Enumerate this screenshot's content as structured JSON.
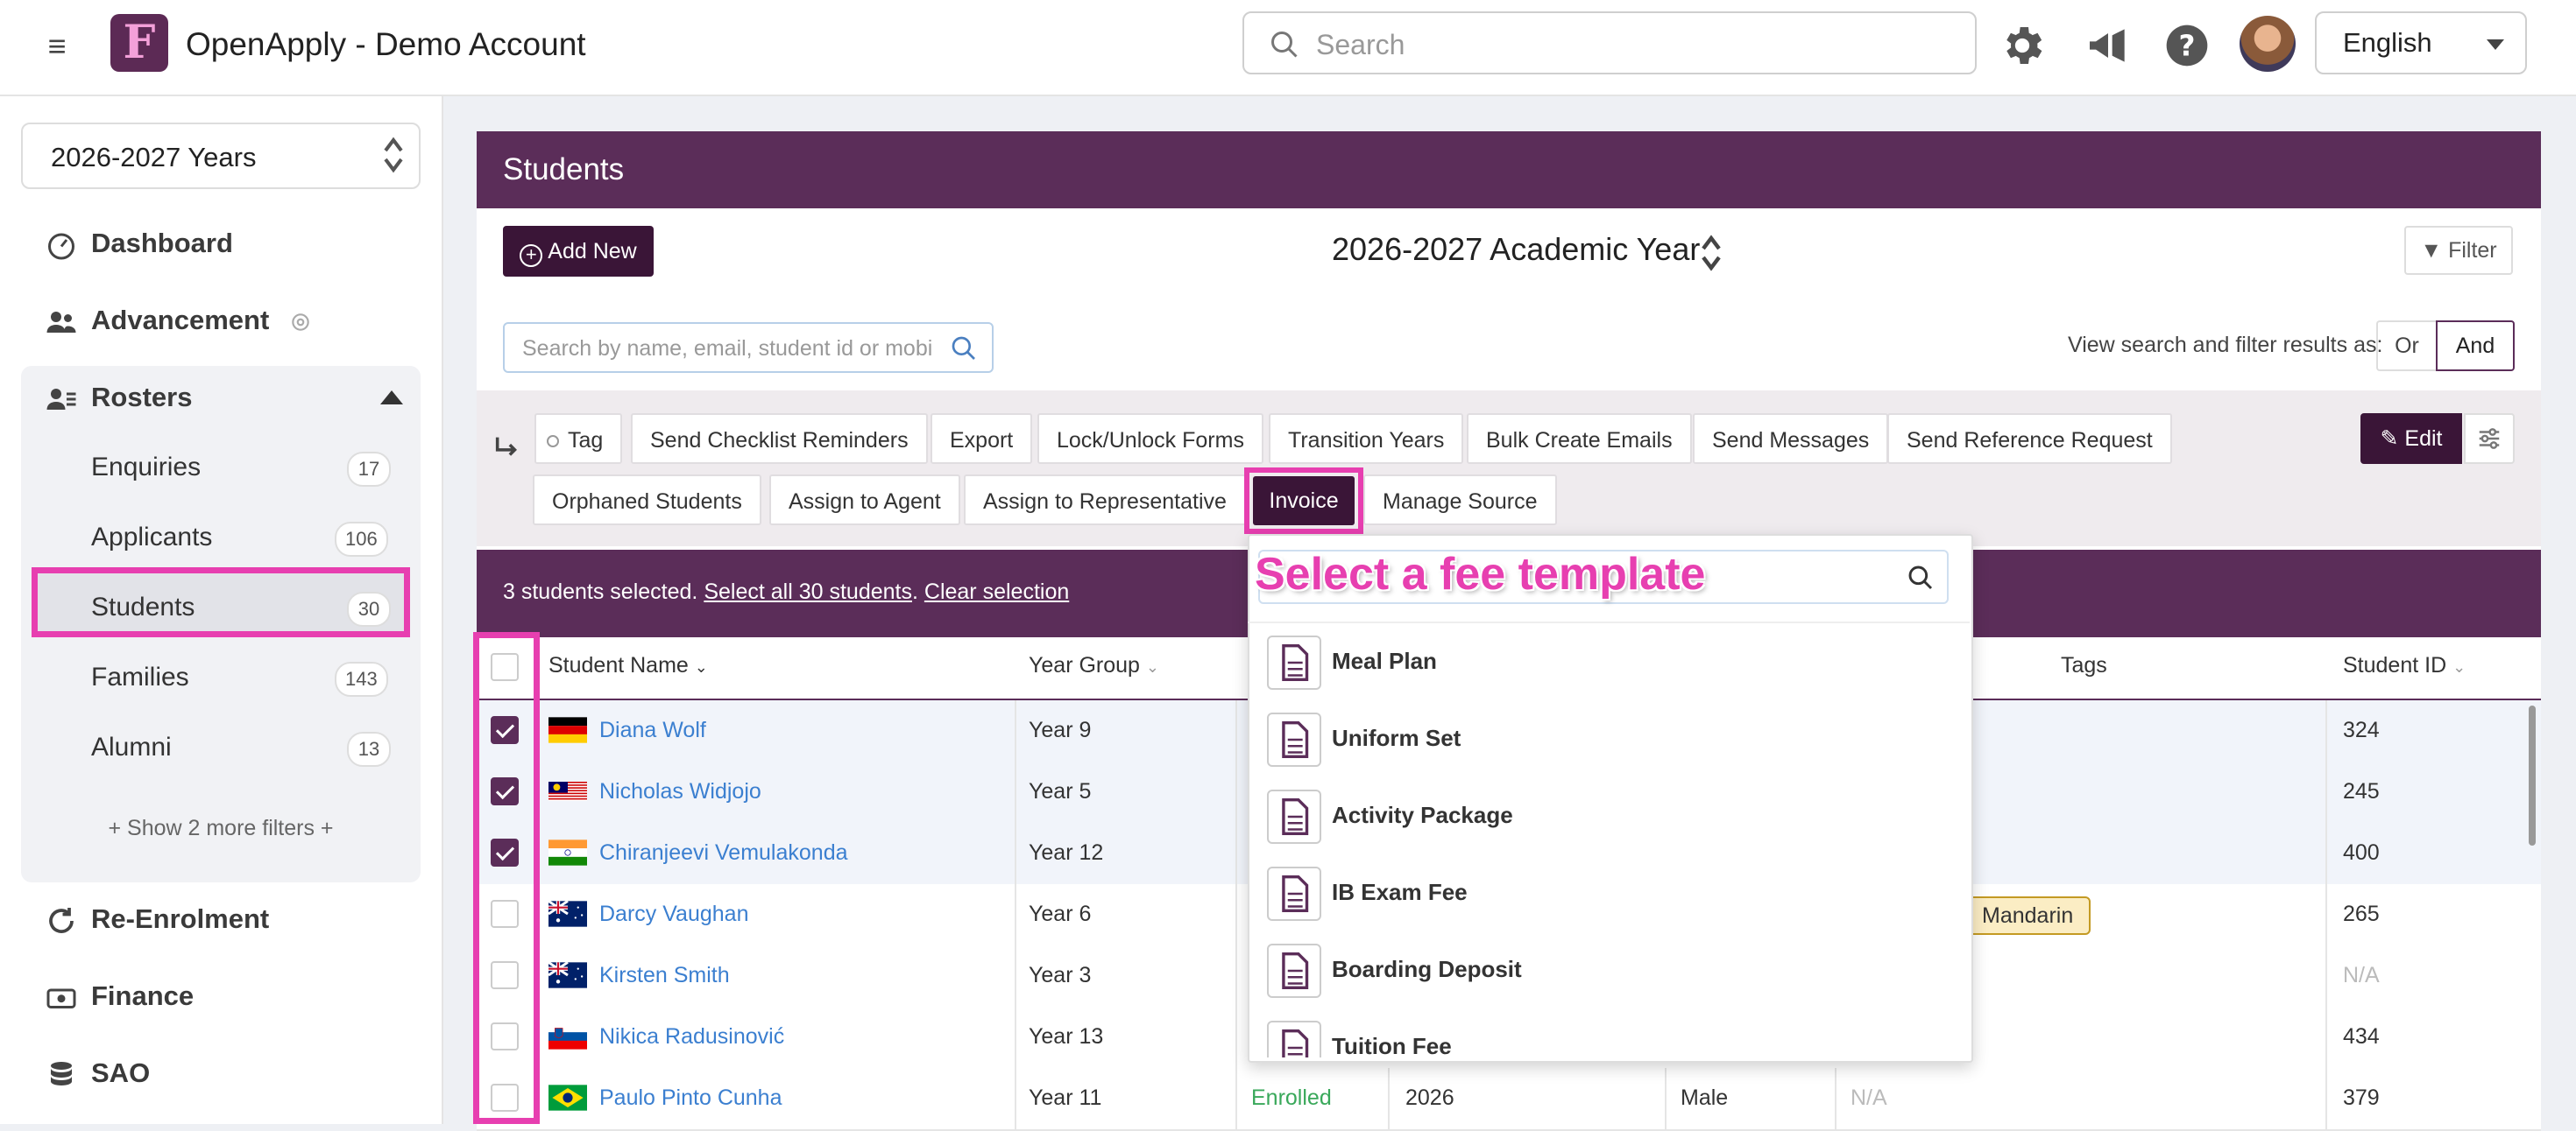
{
  "app": {
    "title": "OpenApply - Demo Account"
  },
  "topbar": {
    "search_placeholder": "Search",
    "language": "English"
  },
  "sidebar": {
    "year_select": "2026-2027 Years",
    "nav": [
      {
        "label": "Dashboard",
        "icon": "dashboard-icon"
      },
      {
        "label": "Advancement",
        "icon": "people-icon"
      },
      {
        "label": "Rosters",
        "icon": "roster-icon"
      }
    ],
    "rosters": [
      {
        "label": "Enquiries",
        "count": "17"
      },
      {
        "label": "Applicants",
        "count": "106"
      },
      {
        "label": "Students",
        "count": "30"
      },
      {
        "label": "Families",
        "count": "143"
      },
      {
        "label": "Alumni",
        "count": "13"
      }
    ],
    "show_more": "+ Show 2 more filters +",
    "nav_bottom": [
      {
        "label": "Re-Enrolment",
        "icon": "refresh-icon"
      },
      {
        "label": "Finance",
        "icon": "money-icon"
      },
      {
        "label": "SAO",
        "icon": "database-icon"
      }
    ]
  },
  "main": {
    "title": "Students",
    "add_new": "Add New",
    "academic_year": "2026-2027 Academic Year",
    "filter": "Filter",
    "search_placeholder": "Search by name, email, student id or mobi",
    "view_label": "View search and filter results as:",
    "or_label": "Or",
    "and_label": "And",
    "actions_row1": [
      "Tag",
      "Send Checklist Reminders",
      "Export",
      "Lock/Unlock Forms",
      "Transition Years",
      "Bulk Create Emails",
      "Send Messages",
      "Send Reference Request"
    ],
    "actions_row2": [
      "Orphaned Students",
      "Assign to Agent",
      "Assign to Representative",
      "Invoice",
      "Manage Source"
    ],
    "edit": "Edit",
    "selection": {
      "text": "3 students selected.",
      "select_all": "Select all 30 students",
      "clear": "Clear selection"
    }
  },
  "table": {
    "headers": {
      "name": "Student Name",
      "year": "Year Group",
      "tags": "Tags",
      "id": "Student ID"
    },
    "rows": [
      {
        "name": "Diana Wolf",
        "flag": "de",
        "year": "Year 9",
        "id": "324",
        "selected": true
      },
      {
        "name": "Nicholas Widjojo",
        "flag": "my",
        "year": "Year 5",
        "id": "245",
        "selected": true
      },
      {
        "name": "Chiranjeevi Vemulakonda",
        "flag": "in",
        "year": "Year 12",
        "id": "400",
        "selected": true
      },
      {
        "name": "Darcy Vaughan",
        "flag": "au",
        "year": "Year 6",
        "id": "265",
        "tag": "Mandarin",
        "selected": false
      },
      {
        "name": "Kirsten Smith",
        "flag": "au",
        "year": "Year 3",
        "id": "N/A",
        "selected": false
      },
      {
        "name": "Nikica Radusinović",
        "flag": "si",
        "year": "Year 13",
        "id": "434",
        "selected": false
      },
      {
        "name": "Paulo Pinto Cunha",
        "flag": "br",
        "year": "Year 11",
        "status": "Enrolled",
        "entry": "2026",
        "gender": "Male",
        "tags_na": "N/A",
        "id": "379",
        "selected": false
      }
    ]
  },
  "dropdown": {
    "label": "Select a fee template",
    "items": [
      "Meal Plan",
      "Uniform Set",
      "Activity Package",
      "IB Exam Fee",
      "Boarding Deposit",
      "Tuition Fee"
    ]
  },
  "colors": {
    "brand": "#5b2d59",
    "highlight": "#e73fb0",
    "link": "#3b7fd0"
  }
}
